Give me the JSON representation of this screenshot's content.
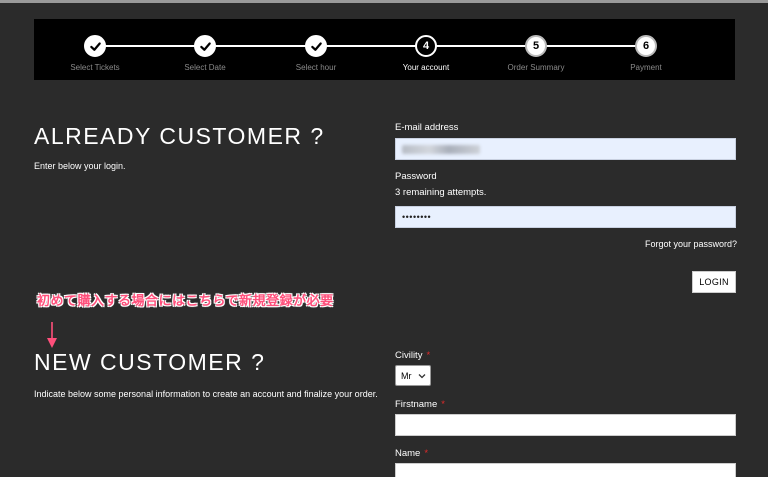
{
  "stepper": {
    "steps": [
      {
        "label": "Select Tickets",
        "state": "done",
        "number": ""
      },
      {
        "label": "Select Date",
        "state": "done",
        "number": ""
      },
      {
        "label": "Select hour",
        "state": "done",
        "number": ""
      },
      {
        "label": "Your account",
        "state": "current",
        "number": "4"
      },
      {
        "label": "Order Summary",
        "state": "todo",
        "number": "5"
      },
      {
        "label": "Payment",
        "state": "todo",
        "number": "6"
      }
    ]
  },
  "existing": {
    "heading": "ALREADY CUSTOMER ?",
    "subtitle": "Enter below your login.",
    "email_label": "E-mail address",
    "password_label": "Password",
    "attempts_text": "3 remaining attempts.",
    "password_value": "••••••••",
    "forgot_link": "Forgot your password?",
    "login_button": "LOGIN"
  },
  "annotation": {
    "text": "初めて購入する場合にはこちらで新規登録が必要",
    "color": "#ff4f7b"
  },
  "new_customer": {
    "heading": "NEW CUSTOMER ?",
    "subtitle": "Indicate below some personal information to create an account and finalize your order.",
    "civility_label": "Civility",
    "civility_value": "Mr",
    "firstname_label": "Firstname",
    "name_label": "Name",
    "required_marker": "*"
  },
  "colors": {
    "background": "#2b2b2b",
    "stepper_bg": "#000000",
    "required": "#e02a2a",
    "autofill": "#e8f0fe"
  }
}
